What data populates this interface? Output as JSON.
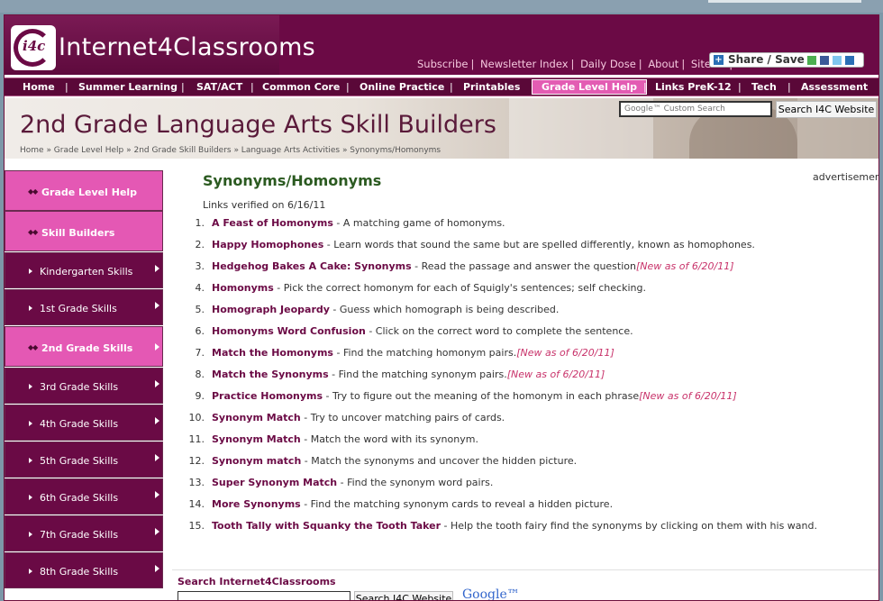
{
  "header": {
    "logo_text": "i4c",
    "site_name": "Internet4Classrooms",
    "top_links": [
      "Subscribe",
      "Newsletter Index",
      "Daily Dose",
      "About",
      "Site Map"
    ],
    "share_label": "Share / Save"
  },
  "nav": {
    "items": [
      "Home",
      "Summer Learning",
      "SAT/ACT",
      "Common Core",
      "Online Practice",
      "Printables",
      "Grade Level Help",
      "Links PreK-12",
      "Tech",
      "Assessment"
    ],
    "active": "Grade Level Help"
  },
  "banner": {
    "title": "2nd Grade Language Arts Skill Builders",
    "breadcrumb": "Home » Grade Level Help » 2nd Grade Skill Builders » Language Arts Activities » Synonyms/Homonyms",
    "search_placeholder": "Google™ Custom Search",
    "search_button": "Search I4C Website"
  },
  "sidebar": {
    "items": [
      {
        "label": "Grade Level Help",
        "style": "pink"
      },
      {
        "label": "Skill Builders",
        "style": "pink"
      },
      {
        "label": "Kindergarten Skills",
        "style": "dark"
      },
      {
        "label": "1st Grade Skills",
        "style": "dark"
      },
      {
        "label": "2nd Grade Skills",
        "style": "pink"
      },
      {
        "label": "3rd Grade Skills",
        "style": "dark"
      },
      {
        "label": "4th Grade Skills",
        "style": "dark"
      },
      {
        "label": "5th Grade Skills",
        "style": "dark"
      },
      {
        "label": "6th Grade Skills",
        "style": "dark"
      },
      {
        "label": "7th Grade Skills",
        "style": "dark"
      },
      {
        "label": "8th Grade Skills",
        "style": "dark"
      }
    ]
  },
  "main": {
    "title": "Synonyms/Homonyms",
    "verified": "Links verified on 6/16/11",
    "advertisement": "advertisement",
    "links": [
      {
        "n": "1.",
        "title": "A Feast of Homonyms",
        "desc": " - A matching game of homonyms.",
        "new": ""
      },
      {
        "n": "2.",
        "title": "Happy Homophones",
        "desc": " - Learn words that sound the same but are spelled differently, known as homophones.",
        "new": ""
      },
      {
        "n": "3.",
        "title": "Hedgehog Bakes A Cake: Synonyms",
        "desc": "  - Read the passage and answer the question",
        "new": "[New as of 6/20/11]"
      },
      {
        "n": "4.",
        "title": "Homonyms",
        "desc": " - Pick the correct homonym for each of Squigly's sentences; self checking.",
        "new": ""
      },
      {
        "n": "5.",
        "title": "Homograph Jeopardy",
        "desc": " - Guess which homograph is being described.",
        "new": ""
      },
      {
        "n": "6.",
        "title": "Homonyms Word Confusion",
        "desc": "  - Click on the correct word to complete the sentence.",
        "new": ""
      },
      {
        "n": "7.",
        "title": "Match the Homonyms",
        "desc": "  - Find the matching homonym pairs.",
        "new": "[New as of 6/20/11]"
      },
      {
        "n": "8.",
        "title": "Match the Synonyms",
        "desc": "  - Find the matching synonym pairs.",
        "new": "[New as of 6/20/11]"
      },
      {
        "n": "9.",
        "title": "Practice Homonyms",
        "desc": "  - Try to figure out the meaning of the homonym in each phrase",
        "new": "[New as of 6/20/11]"
      },
      {
        "n": "10.",
        "title": "Synonym  Match",
        "desc": " - Try to uncover matching pairs of cards.",
        "new": ""
      },
      {
        "n": "11.",
        "title": "Synonym  Match",
        "desc": " - Match the word with its synonym.",
        "new": ""
      },
      {
        "n": "12.",
        "title": "Synonym match",
        "desc": "  - Match the synonyms and uncover the hidden picture.",
        "new": ""
      },
      {
        "n": "13.",
        "title": "Super Synonym  Match",
        "desc": " - Find the synonym word pairs.",
        "new": ""
      },
      {
        "n": "14.",
        "title": "More Synonyms",
        "desc": "  - Find the matching synonym cards to reveal a hidden picture.",
        "new": ""
      },
      {
        "n": "15.",
        "title": "Tooth Tally with Squanky the Tooth Taker",
        "desc": "   - Help the tooth fairy find the synonyms by clicking on them with his wand.",
        "new": ""
      }
    ]
  },
  "bottom_search": {
    "label": "Search Internet4Classrooms",
    "button": "Search I4C Website",
    "google": "Google™"
  },
  "colors": {
    "brand": "#6b0a45",
    "accent_pink": "#e458b4",
    "title_green": "#2b5a20",
    "new_red": "#c8326a"
  }
}
